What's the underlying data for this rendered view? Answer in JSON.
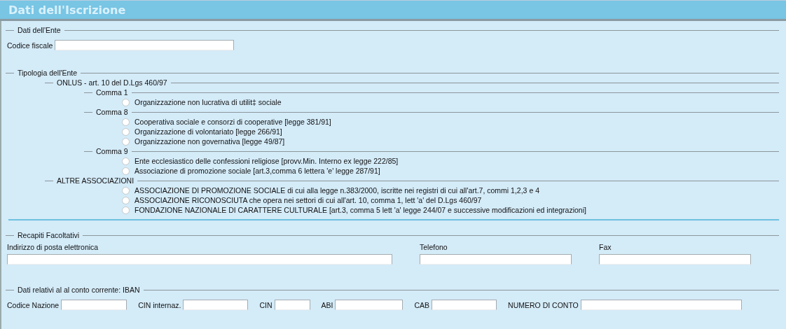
{
  "title": "Dati dell'Iscrizione",
  "ente": {
    "legend": "Dati dell'Ente",
    "fields": [
      {
        "label": "Codice fiscale"
      }
    ]
  },
  "tipologia": {
    "legend": "Tipologia dell'Ente",
    "groups": [
      {
        "label": "ONLUS - art. 10 del D.Lgs 460/97",
        "children": [
          {
            "label": "Comma 1",
            "options": [
              {
                "label": "Organizzazione non lucrativa di utilit‡ sociale",
                "selected": false
              }
            ]
          },
          {
            "label": "Comma 8",
            "options": [
              {
                "label": "Cooperativa sociale e consorzi di cooperative [legge 381/91]",
                "selected": false
              },
              {
                "label": "Organizzazione di volontariato [legge 266/91]",
                "selected": false
              },
              {
                "label": "Organizzazione non governativa [legge 49/87]",
                "selected": false
              }
            ]
          },
          {
            "label": "Comma 9",
            "options": [
              {
                "label": "Ente ecclesiastico delle confessioni religiose [provv.Min. Interno ex legge 222/85]",
                "selected": false
              },
              {
                "label": "Associazione di promozione sociale [art.3,comma 6 lettera 'e' legge 287/91]",
                "selected": false
              }
            ]
          }
        ]
      },
      {
        "label": "ALTRE ASSOCIAZIONI",
        "options": [
          {
            "label": "ASSOCIAZIONE DI PROMOZIONE SOCIALE di cui alla legge n.383/2000, iscritte nei registri di cui all'art.7, commi 1,2,3 e 4",
            "selected": false
          },
          {
            "label": "ASSOCIAZIONE RICONOSCIUTA che opera nei settori di cui all'art. 10, comma 1, lett 'a' del D.Lgs 460/97",
            "selected": false
          },
          {
            "label": "FONDAZIONE NAZIONALE DI CARATTERE CULTURALE [art.3, comma 5 lett 'a' legge 244/07 e successive modificazioni ed integrazioni]",
            "selected": false
          }
        ]
      }
    ]
  },
  "recapiti": {
    "legend": "Recapiti Facoltativi",
    "fields": [
      {
        "label": "Indirizzo di posta elettronica"
      },
      {
        "label": "Telefono"
      },
      {
        "label": "Fax"
      }
    ]
  },
  "iban": {
    "legend": "Dati  relativi al al conto corrente: IBAN",
    "fields": [
      {
        "label": "Codice Nazione"
      },
      {
        "label": "CIN internaz."
      },
      {
        "label": "CIN"
      },
      {
        "label": "ABI"
      },
      {
        "label": "CAB"
      },
      {
        "label": "NUMERO DI CONTO"
      }
    ]
  }
}
